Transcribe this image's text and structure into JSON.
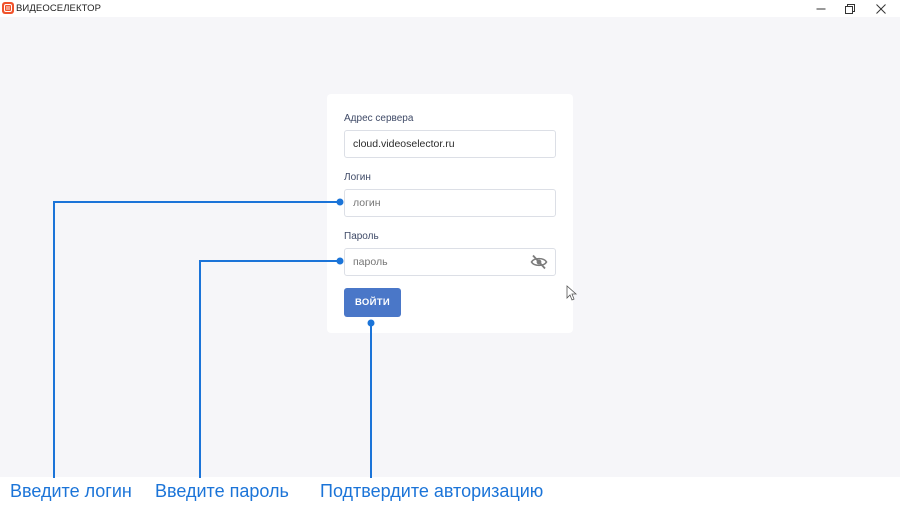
{
  "app": {
    "title": "ВИДЕОСЕЛЕКТОР",
    "logo_icon": "videoselector-logo-icon"
  },
  "window_controls": {
    "minimize_icon": "minimize-icon",
    "restore_icon": "restore-icon",
    "close_icon": "close-icon"
  },
  "form": {
    "server": {
      "label": "Адрес сервера",
      "value": "cloud.videoselector.ru"
    },
    "login": {
      "label": "Логин",
      "placeholder": "логин"
    },
    "password": {
      "label": "Пароль",
      "placeholder": "пароль",
      "toggle_icon": "eye-off-icon"
    },
    "submit_label": "ВОЙТИ"
  },
  "callouts": {
    "login": "Введите логин",
    "password": "Введите пароль",
    "submit": "Подтвердите авторизацию"
  },
  "colors": {
    "accent": "#4a77c8",
    "callout": "#1b74d8",
    "background": "#f6f6f9",
    "logo": "#f0522b"
  }
}
